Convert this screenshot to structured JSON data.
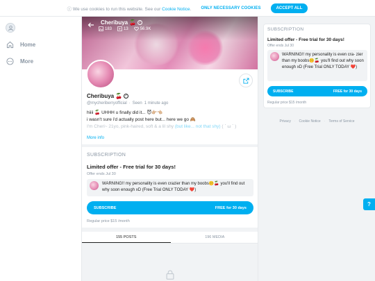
{
  "cookie": {
    "text": "We use cookies to run this website. See our",
    "link": "Cookie Notice",
    "period": ".",
    "necessary_label": "ONLY NECESSARY COOKIES",
    "accept_label": "ACCEPT ALL"
  },
  "nav": {
    "home_label": "Home",
    "more_label": "More"
  },
  "profile": {
    "top_name": "Cheribuya",
    "top_emoji": "🍒",
    "stats": {
      "photos": "183",
      "videos": "13",
      "likes": "56.9K"
    },
    "name": "Cheribuya",
    "name_emoji": "🍒",
    "handle": "@mycheriberryofficial",
    "separator": "·",
    "seen": "Seen",
    "seen_time": "1 minute ago",
    "bio_line1": "hiiii 🍒 UHHH u finally did it... 😈👉🏼👈🏼",
    "bio_line2": "i wasn't sure i'd actually post here but... here we go 🙈",
    "bio_line3": "I'm Cheri~ 21yo, pink-haired, soft & a lil shy",
    "bio_line3_faded": "(but like... not that shy)",
    "bio_line3_end": "( ˊ ω ˋ )",
    "more_info": "More info"
  },
  "subscription": {
    "heading": "SUBSCRIPTION",
    "offer_title": "Limited offer - Free trial for 30 days!",
    "offer_ends": "Offer ends Jul 30",
    "message": "WARNING!! my personality is even crazier than my boobs🤫🍒 you'll find out why soon enough xD (Free Trial ONLY TODAY ❤️)",
    "button_left": "SUBSCRIBE",
    "button_right": "FREE for 30 days",
    "regular_price": "Regular price $15 /month"
  },
  "right_card": {
    "message": "WARNING!! my personality is even cra- zier than my boobs🤫🍒 you'll find out why soon enough xD (Free Trial ONLY TODAY ❤️)"
  },
  "tabs": [
    {
      "label": "155 POSTS"
    },
    {
      "label": "196 MEDIA"
    }
  ],
  "footer": {
    "privacy": "Privacy",
    "cookie_notice": "Cookie Notice",
    "terms": "Terms of Service",
    "dot": "·"
  },
  "help_label": "?",
  "colors": {
    "accent": "#00aff0",
    "muted": "#8a96a3",
    "background": "#f1f3f5"
  }
}
